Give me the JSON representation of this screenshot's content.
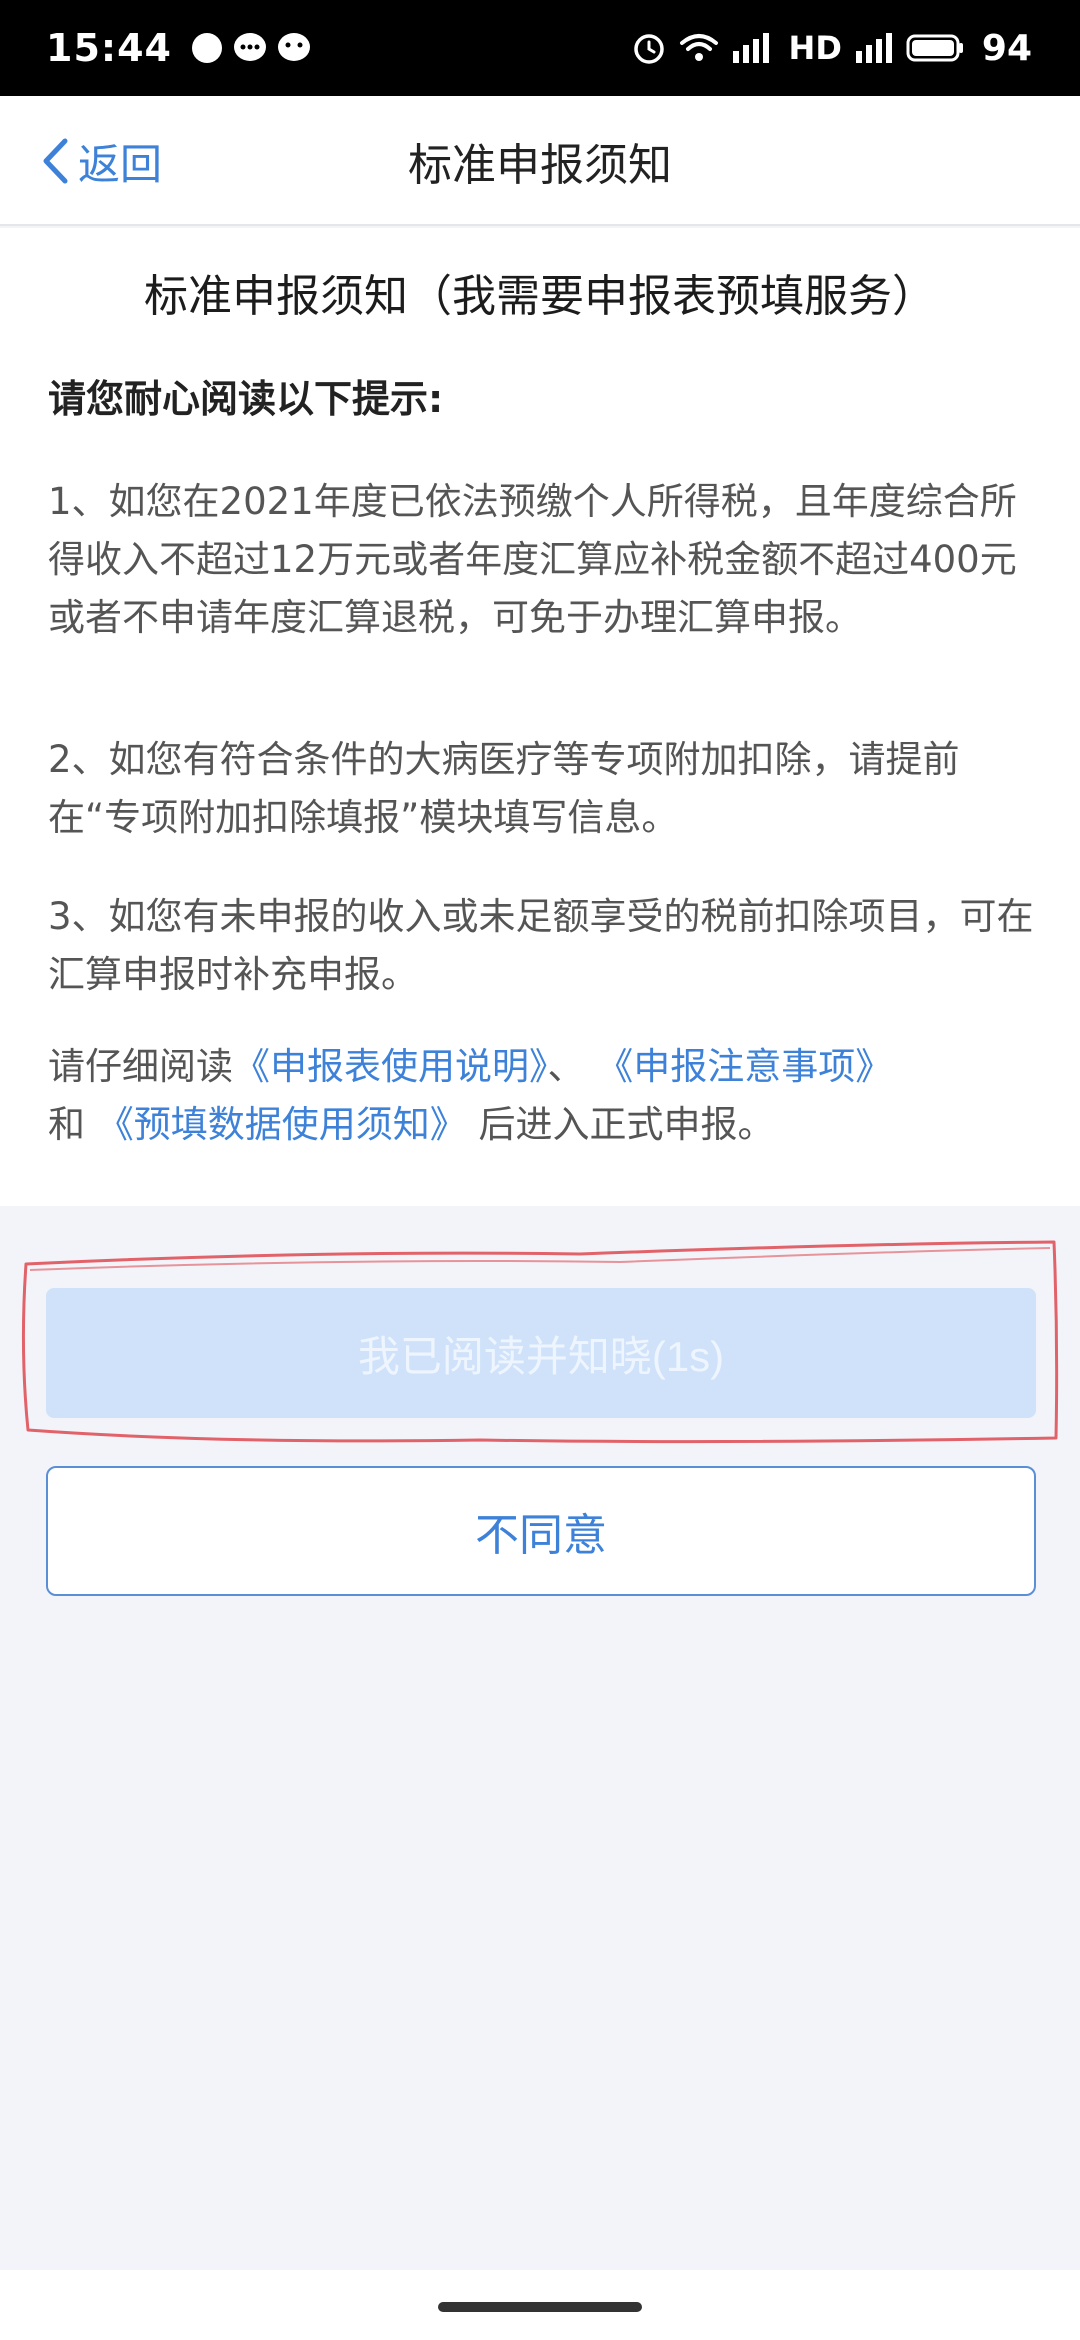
{
  "status_bar": {
    "time": "15:44",
    "network_label": "HD",
    "battery": "94"
  },
  "nav": {
    "back_label": "返回",
    "title": "标准申报须知"
  },
  "content": {
    "title": "标准申报须知（我需要申报表预填服务）",
    "subhead": "请您耐心阅读以下提示:",
    "para1": "1、如您在2021年度已依法预缴个人所得税，且年度综合所得收入不超过12万元或者年度汇算应补税金额不超过400元或者不申请年度汇算退税，可免于办理汇算申报。",
    "para2": "2、如您有符合条件的大病医疗等专项附加扣除，请提前在“专项附加扣除填报”模块填写信息。",
    "para3": "3、如您有未申报的收入或未足额享受的税前扣除项目，可在汇算申报时补充申报。",
    "para4_prefix": "请仔细阅读",
    "link1": "《申报表使用说明》",
    "sep1": "、",
    "link2": "《申报注意事项》",
    "and": "和",
    "link3": "《预填数据使用须知》",
    "para4_suffix": "后进入正式申报。"
  },
  "buttons": {
    "agree": "我已阅读并知晓(1s)",
    "disagree": "不同意"
  },
  "colors": {
    "accent": "#3d82d8",
    "agree_disabled_bg": "#cfe2f9",
    "annotation": "#e0525a"
  }
}
